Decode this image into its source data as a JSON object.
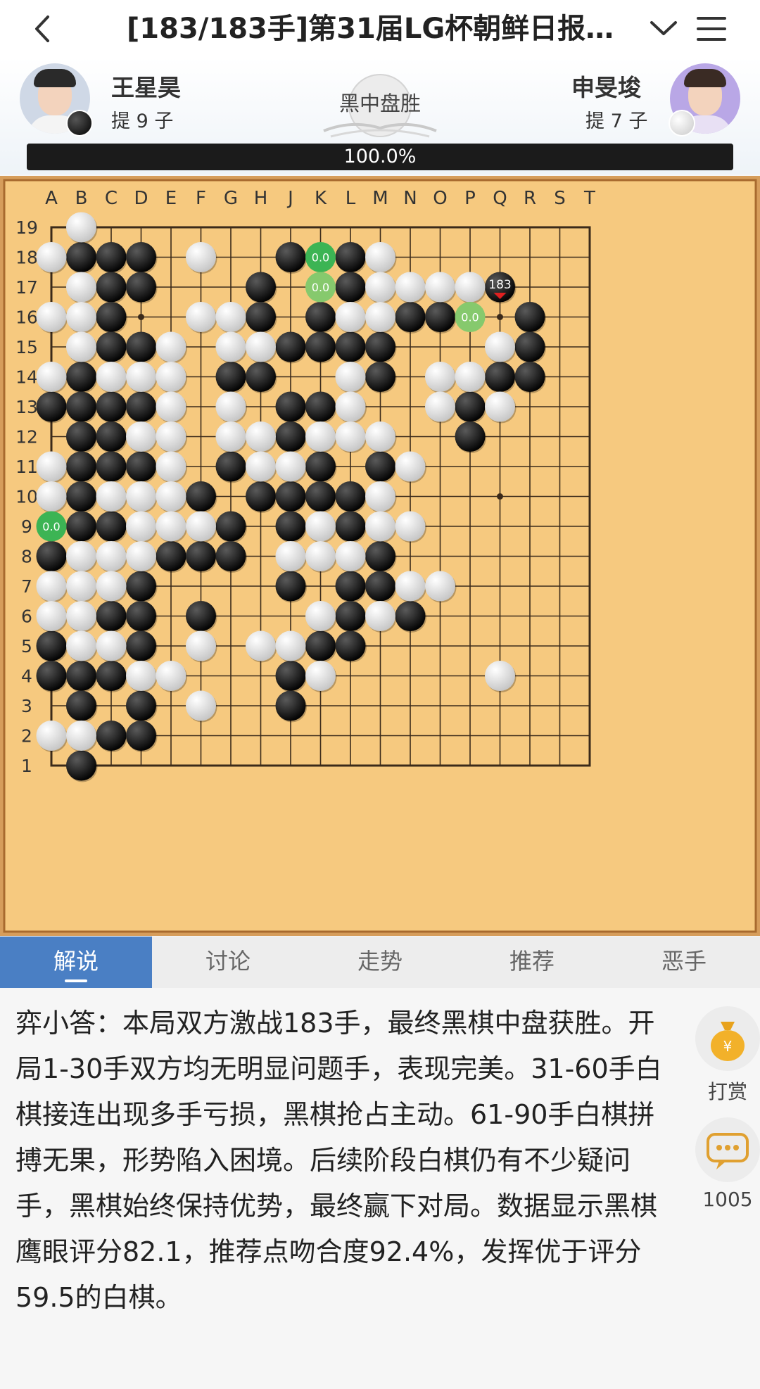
{
  "header": {
    "title": "[183/183手]第31届LG杯朝鲜日报…",
    "back_icon": "chevron-left-icon",
    "expand_icon": "chevron-down-icon",
    "menu_icon": "hamburger-menu-icon"
  },
  "players": {
    "black": {
      "name": "王星昊",
      "captures": "提 9 子",
      "color": "#000000"
    },
    "white": {
      "name": "申旻埈",
      "captures": "提 7 子",
      "color": "#ffffff"
    },
    "result": "黑中盘胜",
    "win_rate_label": "100.0%",
    "win_rate": 100.0
  },
  "board": {
    "size": 19,
    "col_labels": [
      "A",
      "B",
      "C",
      "D",
      "E",
      "F",
      "G",
      "H",
      "J",
      "K",
      "L",
      "M",
      "N",
      "O",
      "P",
      "Q",
      "R",
      "S",
      "T"
    ],
    "row_labels": [
      "19",
      "18",
      "17",
      "16",
      "15",
      "14",
      "13",
      "12",
      "11",
      "10",
      "9",
      "8",
      "7",
      "6",
      "5",
      "4",
      "3",
      "2",
      "1"
    ],
    "black": [
      "B18",
      "C18",
      "D18",
      "J18",
      "L18",
      "C17",
      "D17",
      "H17",
      "L17",
      "C16",
      "H16",
      "K16",
      "N16",
      "O16",
      "R16",
      "C15",
      "D15",
      "J15",
      "K15",
      "L15",
      "M15",
      "R15",
      "B14",
      "G14",
      "H14",
      "M14",
      "Q14",
      "R14",
      "A13",
      "B13",
      "C13",
      "D13",
      "J13",
      "K13",
      "P13",
      "B12",
      "C12",
      "J12",
      "P12",
      "B11",
      "C11",
      "D11",
      "G11",
      "K11",
      "M11",
      "B10",
      "F10",
      "H10",
      "J10",
      "K10",
      "L10",
      "B9",
      "C9",
      "G9",
      "J9",
      "L9",
      "A8",
      "E8",
      "F8",
      "G8",
      "M8",
      "D7",
      "J7",
      "L7",
      "M7",
      "C6",
      "D6",
      "F6",
      "L6",
      "N6",
      "A5",
      "D5",
      "K5",
      "L5",
      "A4",
      "B4",
      "C4",
      "J4",
      "B3",
      "D3",
      "J3",
      "C2",
      "D2",
      "B1",
      "Q17"
    ],
    "white": [
      "B19",
      "A18",
      "F18",
      "M18",
      "B17",
      "M17",
      "N17",
      "O17",
      "P17",
      "A16",
      "B16",
      "F16",
      "G16",
      "L16",
      "M16",
      "B15",
      "E15",
      "G15",
      "H15",
      "Q15",
      "A14",
      "C14",
      "D14",
      "E14",
      "L14",
      "O14",
      "P14",
      "E13",
      "G13",
      "L13",
      "O13",
      "Q13",
      "D12",
      "E12",
      "G12",
      "H12",
      "K12",
      "L12",
      "M12",
      "A11",
      "E11",
      "H11",
      "J11",
      "N11",
      "A10",
      "C10",
      "D10",
      "E10",
      "M10",
      "D9",
      "E9",
      "F9",
      "K9",
      "M9",
      "N9",
      "B8",
      "C8",
      "D8",
      "J8",
      "K8",
      "L8",
      "A7",
      "B7",
      "C7",
      "N7",
      "O7",
      "A6",
      "B6",
      "K6",
      "M6",
      "B5",
      "C5",
      "F5",
      "H5",
      "J5",
      "D4",
      "E4",
      "K4",
      "Q4",
      "F3",
      "A2",
      "B2"
    ],
    "last_move": {
      "point": "Q17",
      "number": "183",
      "marker_color": "#e02020"
    },
    "hints": [
      {
        "point": "K18",
        "value": "0.0",
        "strength": "strong"
      },
      {
        "point": "K17",
        "value": "0.0",
        "strength": "weak"
      },
      {
        "point": "P16",
        "value": "0.0",
        "strength": "weak"
      },
      {
        "point": "A9",
        "value": "0.0",
        "strength": "strong"
      }
    ],
    "star_points": [
      "D16",
      "K16",
      "Q16",
      "D10",
      "K10",
      "Q10",
      "D4",
      "K4",
      "Q4"
    ],
    "colors": {
      "wood": "#f6c97f",
      "frame": "#d69d5b",
      "line": "#3b2a1a",
      "hint_strong": "#3cb454",
      "hint_weak": "#86c96d"
    }
  },
  "tabs": [
    {
      "label": "解说",
      "active": true
    },
    {
      "label": "讨论",
      "active": false
    },
    {
      "label": "走势",
      "active": false
    },
    {
      "label": "推荐",
      "active": false
    },
    {
      "label": "恶手",
      "active": false
    }
  ],
  "commentary": {
    "text": "弈小答：本局双方激战183手，最终黑棋中盘获胜。开局1-30手双方均无明显问题手，表现完美。31-60手白棋接连出现多手亏损，黑棋抢占主动。61-90手白棋拼搏无果，形势陷入困境。后续阶段白棋仍有不少疑问手，黑棋始终保持优势，最终赢下对局。数据显示黑棋鹰眼评分82.1，推荐点吻合度92.4%，发挥优于评分59.5的白棋。"
  },
  "side_actions": {
    "tip": {
      "label": "打赏",
      "icon": "money-bag-icon"
    },
    "comments": {
      "count": "1005",
      "icon": "chat-bubble-icon"
    }
  }
}
